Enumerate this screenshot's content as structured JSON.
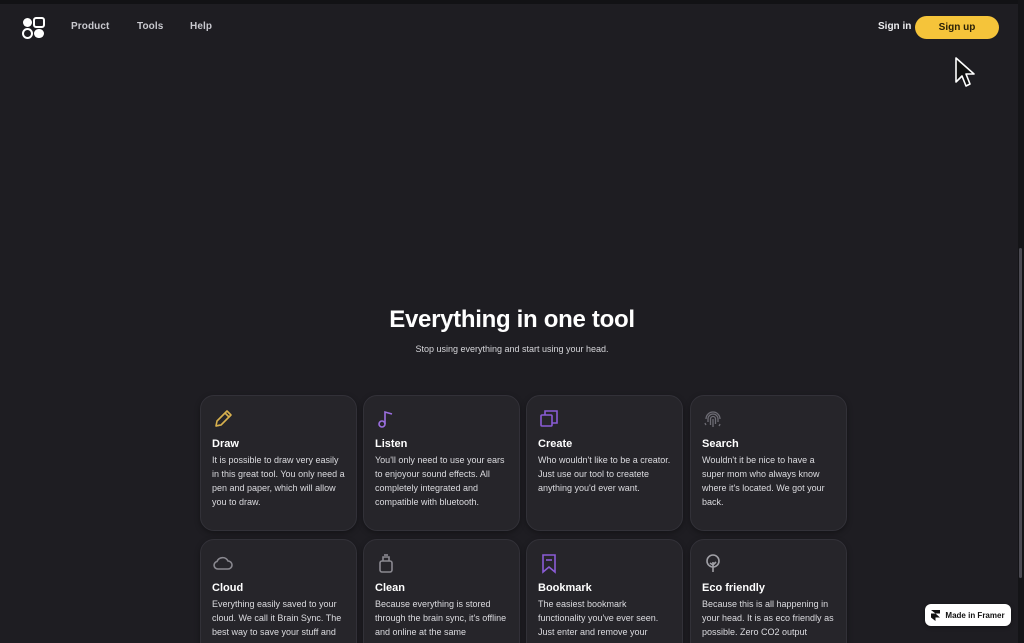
{
  "nav": {
    "links": [
      {
        "label": "Product"
      },
      {
        "label": "Tools"
      },
      {
        "label": "Help"
      }
    ],
    "signin_label": "Sign in",
    "signup_label": "Sign up"
  },
  "hero": {
    "title": "Everything in one tool",
    "subtitle": "Stop using everything and start using your head."
  },
  "features": [
    {
      "title": "Draw",
      "icon": "pencil-icon",
      "color": "#d8b14e",
      "desc": "It is possible to draw very easily in this great tool. You only need a pen and paper, which will allow you to draw."
    },
    {
      "title": "Listen",
      "icon": "music-note-icon",
      "color": "#9b6fe0",
      "desc": "You'll only need to use your ears to enjoyour sound effects. All completely integrated and compatible with bluetooth."
    },
    {
      "title": "Create",
      "icon": "copy-icon",
      "color": "#8a5cd6",
      "desc": "Who wouldn't like to be a creator. Just use our tool to createte anything you'd ever want."
    },
    {
      "title": "Search",
      "icon": "fingerprint-icon",
      "color": "#6d6c74",
      "desc": "Wouldn't it be nice to have a super mom who always know where it's located. We got your back."
    },
    {
      "title": "Cloud",
      "icon": "cloud-icon",
      "color": "#8a8990",
      "desc": "Everything easily saved to your cloud. We call it Brain Sync. The best way to save your stuff and"
    },
    {
      "title": "Clean",
      "icon": "spray-bottle-icon",
      "color": "#8a8990",
      "desc": "Because everything is stored through the brain sync, it's offline and online at the same"
    },
    {
      "title": "Bookmark",
      "icon": "bookmark-icon",
      "color": "#8a5cd6",
      "desc": "The easiest bookmark functionality you've ever seen. Just enter and remove your"
    },
    {
      "title": "Eco friendly",
      "icon": "tree-icon",
      "color": "#a0a0a6",
      "desc": "Because this is all happening in your head. It is as eco friendly as possible. Zero CO2 output"
    }
  ],
  "badge": {
    "label": "Made in Framer"
  },
  "colors": {
    "accent": "#f5c43a",
    "background": "#1e1d22",
    "card": "#26252a"
  }
}
